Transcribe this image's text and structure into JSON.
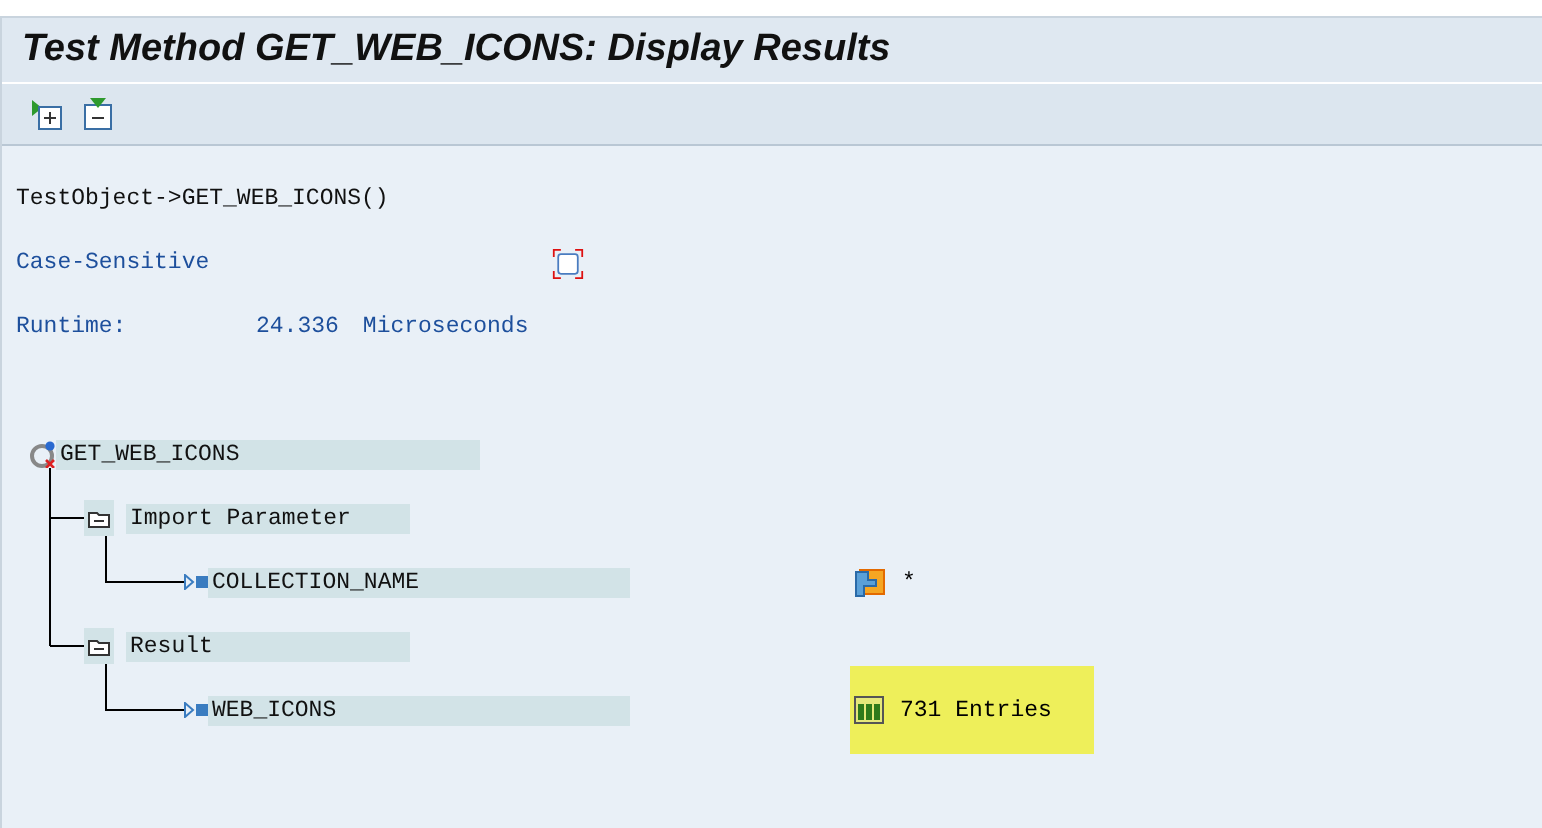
{
  "window": {
    "title": "Test Method GET_WEB_ICONS: Display Results"
  },
  "call": "TestObject->GET_WEB_ICONS()",
  "case_sensitive": {
    "label": "Case-Sensitive",
    "checked": false
  },
  "runtime": {
    "label": "Runtime:",
    "value": "24.336",
    "unit": "Microseconds"
  },
  "tree": {
    "label": "GET_WEB_ICONS",
    "children": [
      {
        "label": "Import Parameter",
        "expanded": true,
        "children": [
          {
            "label": "COLLECTION_NAME",
            "kind": "parameter",
            "value": "*",
            "highlighted": false
          }
        ]
      },
      {
        "label": "Result",
        "expanded": true,
        "children": [
          {
            "label": "WEB_ICONS",
            "kind": "table",
            "value": "731 Entries",
            "highlighted": true
          }
        ]
      }
    ]
  }
}
